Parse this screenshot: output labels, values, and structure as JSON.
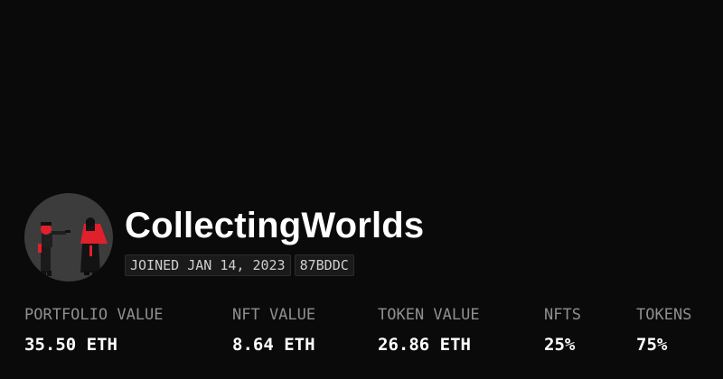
{
  "profile": {
    "username": "CollectingWorlds",
    "joined": "JOINED JAN 14, 2023",
    "code": "87BDDC",
    "avatar_icon": "profile-avatar-art"
  },
  "stats": [
    {
      "label": "PORTFOLIO VALUE",
      "value": "35.50 ETH"
    },
    {
      "label": "NFT VALUE",
      "value": "8.64 ETH"
    },
    {
      "label": "TOKEN VALUE",
      "value": "26.86 ETH"
    },
    {
      "label": "NFTS",
      "value": "25%"
    },
    {
      "label": "TOKENS",
      "value": "75%"
    }
  ],
  "colors": {
    "background": "#0a0a0a",
    "text": "#ffffff",
    "muted": "#8f8f8f",
    "chip_bg": "#1a1a1a",
    "avatar_bg": "#3c3c3c",
    "accent_red": "#e0202a"
  }
}
